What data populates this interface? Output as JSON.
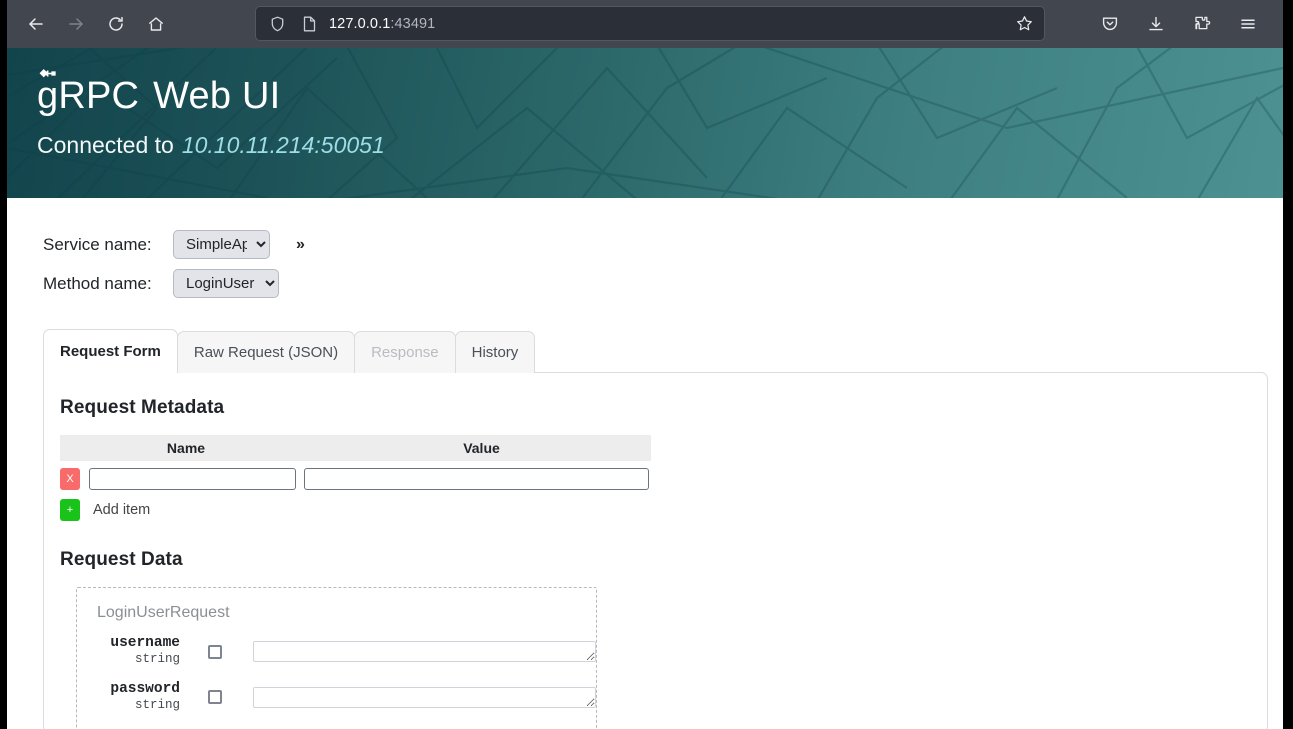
{
  "browser": {
    "url_host": "127.0.0.1",
    "url_port": ":43491",
    "back_icon": "back-arrow-icon",
    "forward_icon": "forward-arrow-icon",
    "reload_icon": "reload-icon",
    "home_icon": "home-icon",
    "shield_icon": "shield-icon",
    "page_icon": "page-icon",
    "bookmark_icon": "star-icon",
    "pocket_icon": "pocket-icon",
    "downloads_icon": "download-icon",
    "extensions_icon": "extensions-icon",
    "menu_icon": "hamburger-menu-icon"
  },
  "header": {
    "title_grpc": "gRPC",
    "title_ui": "Web UI",
    "connected_label": "Connected to",
    "connected_address": "10.10.11.214:50051",
    "gradient_from": "#12444c",
    "gradient_to": "#4d9193",
    "address_color": "#9fdde6"
  },
  "selectors": {
    "service_label": "Service name:",
    "service_value": "SimpleApp",
    "service_options": [
      "SimpleApp"
    ],
    "method_label": "Method name:",
    "method_value": "LoginUser",
    "method_options": [
      "LoginUser"
    ],
    "expand_label": "»"
  },
  "tabs": [
    {
      "label": "Request Form",
      "state": "active"
    },
    {
      "label": "Raw Request (JSON)",
      "state": "enabled"
    },
    {
      "label": "Response",
      "state": "disabled"
    },
    {
      "label": "History",
      "state": "enabled"
    }
  ],
  "metadata": {
    "title": "Request Metadata",
    "columns": [
      "Name",
      "Value"
    ],
    "rows": [
      {
        "name": "",
        "value": "",
        "delete_label": "X"
      }
    ],
    "add_button_label": "+",
    "add_item_label": "Add item",
    "delete_color": "#f96a6a",
    "add_color": "#19c319"
  },
  "request_data": {
    "title": "Request Data",
    "message_type": "LoginUserRequest",
    "fields": [
      {
        "name": "username",
        "type": "string",
        "checked": false,
        "value": ""
      },
      {
        "name": "password",
        "type": "string",
        "checked": false,
        "value": ""
      }
    ]
  }
}
